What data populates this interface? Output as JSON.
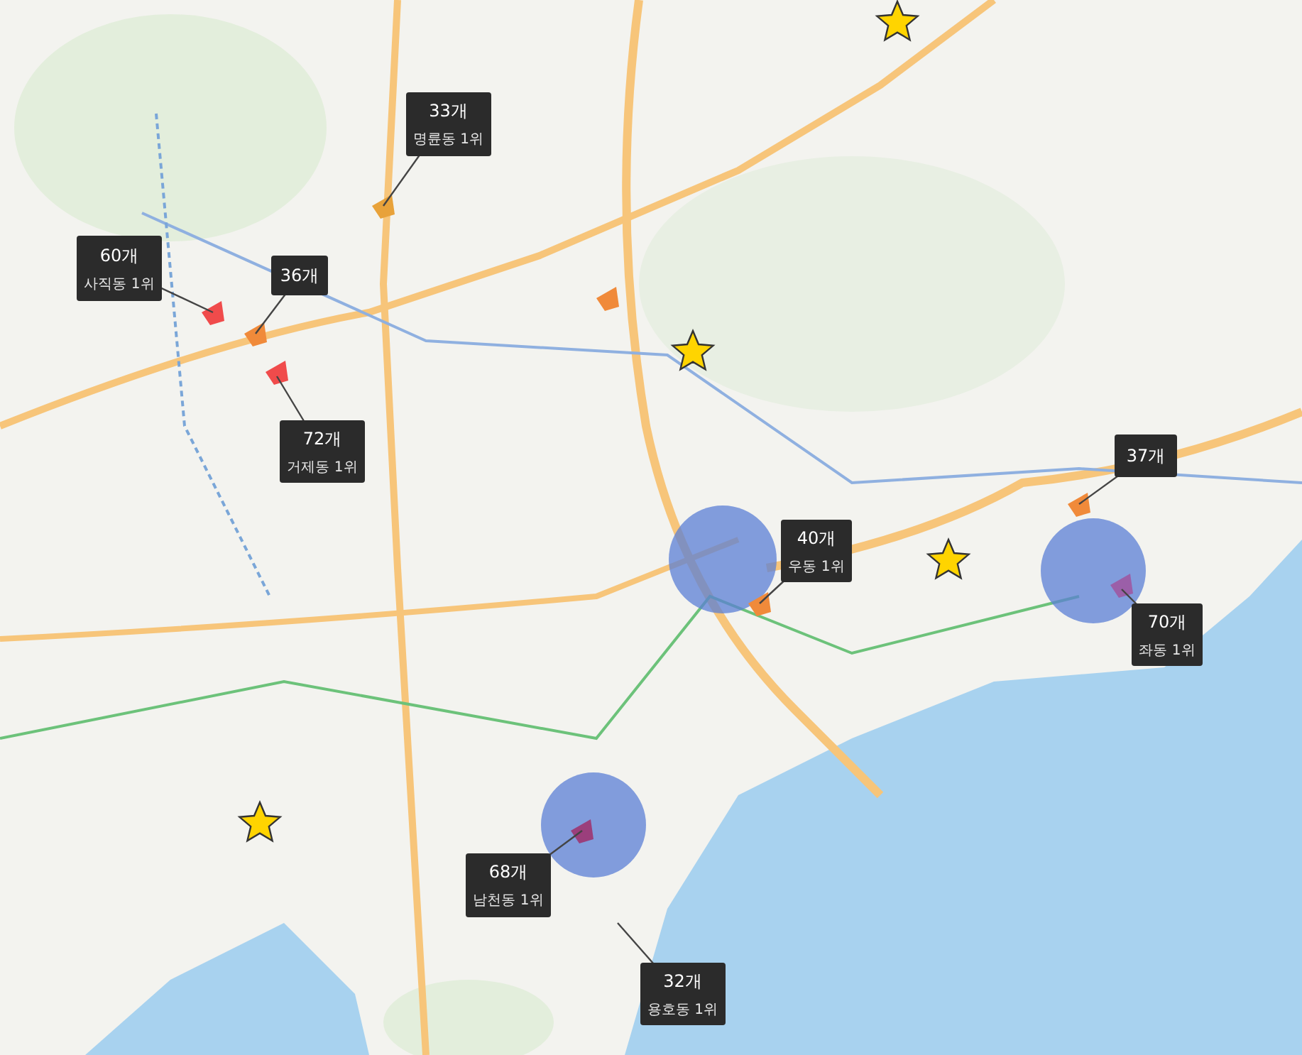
{
  "callouts": [
    {
      "count": "33개",
      "rank": "명륜동 1위"
    },
    {
      "count": "60개",
      "rank": "사직동 1위"
    },
    {
      "count": "36개"
    },
    {
      "count": "72개",
      "rank": "거제동 1위"
    },
    {
      "count": "40개",
      "rank": "우동 1위"
    },
    {
      "count": "37개"
    },
    {
      "count": "70개",
      "rank": "좌동 1위"
    },
    {
      "count": "68개",
      "rank": "남천동 1위"
    },
    {
      "count": "32개",
      "rank": "용호동 1위"
    }
  ]
}
